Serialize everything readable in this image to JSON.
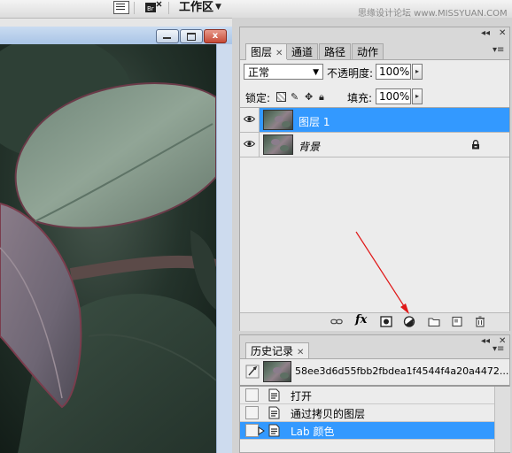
{
  "toolbar": {
    "workspace_label": "工作区",
    "watermark": "思缘设计论坛 www.MISSYUAN.COM"
  },
  "document": {
    "close_glyph": "x"
  },
  "layers_panel": {
    "tabs": [
      {
        "label": "图层",
        "active": true
      },
      {
        "label": "通道",
        "active": false
      },
      {
        "label": "路径",
        "active": false
      },
      {
        "label": "动作",
        "active": false
      }
    ],
    "blend_mode": "正常",
    "opacity_label": "不透明度:",
    "opacity_value": "100%",
    "lock_label": "锁定:",
    "fill_label": "填充:",
    "fill_value": "100%",
    "layers": [
      {
        "name": "图层 1",
        "selected": true,
        "locked": false
      },
      {
        "name": "背景",
        "selected": false,
        "locked": true
      }
    ],
    "bottom_icons": [
      "link-icon",
      "fx-icon",
      "mask-icon",
      "adjustment-layer-icon",
      "folder-icon",
      "new-layer-icon",
      "trash-icon"
    ],
    "fx_label": "fx"
  },
  "history_panel": {
    "tab_label": "历史记录",
    "snapshot_name": "58ee3d6d55fbb2fbdea1f4544f4a20a4472...",
    "items": [
      {
        "label": "打开",
        "selected": false
      },
      {
        "label": "通过拷贝的图层",
        "selected": false
      },
      {
        "label": "Lab 颜色",
        "selected": true
      }
    ]
  },
  "colors": {
    "selection": "#3399ff",
    "annotation_arrow": "#e01818",
    "panel_bg": "#ececec",
    "window_frame": "#8fb2dc"
  }
}
